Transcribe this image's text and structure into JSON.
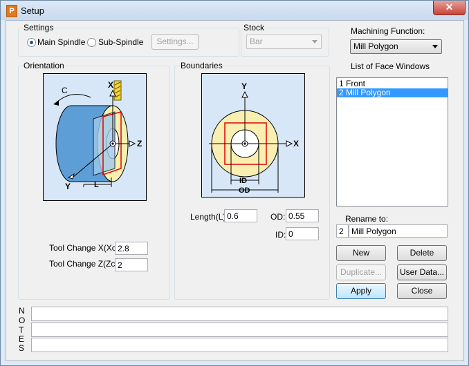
{
  "window": {
    "title": "Setup",
    "close_glyph": "✕"
  },
  "settings": {
    "group_label": "Settings",
    "main_spindle_label": "Main Spindle",
    "sub_spindle_label": "Sub-Spindle",
    "selected": "Main Spindle",
    "settings_button": "Settings..."
  },
  "stock": {
    "group_label": "Stock",
    "value": "Bar"
  },
  "machining_function": {
    "label": "Machining Function:",
    "value": "Mill Polygon"
  },
  "face_windows": {
    "label": "List of Face Windows",
    "items": [
      "1 Front",
      "2 Mill Polygon"
    ],
    "selected_index": 1
  },
  "rename": {
    "label": "Rename to:",
    "number": "2",
    "name": "Mill Polygon"
  },
  "orientation": {
    "group_label": "Orientation",
    "diagram_labels": {
      "c": "C",
      "x": "X",
      "z": "Z",
      "y": "Y",
      "l": "L"
    },
    "tool_change_x_label": "Tool Change X(Xc):",
    "tool_change_x_value": "2.8",
    "tool_change_z_label": "Tool Change Z(Zc):",
    "tool_change_z_value": "2"
  },
  "boundaries": {
    "group_label": "Boundaries",
    "diagram_labels": {
      "y": "Y",
      "x": "X",
      "id": "ID",
      "od": "OD"
    },
    "length_label": "Length(L):",
    "length_value": "0.6",
    "od_label": "OD:",
    "od_value": "0.55",
    "id_label": "ID:",
    "id_value": "0"
  },
  "buttons": {
    "new": "New",
    "delete": "Delete",
    "duplicate": "Duplicate...",
    "user_data": "User Data...",
    "apply": "Apply",
    "close": "Close"
  },
  "notes": {
    "letters": [
      "N",
      "O",
      "T",
      "E",
      "S"
    ]
  },
  "colors": {
    "selection": "#3399ff",
    "diagram_bg": "#d7e7f8",
    "cylinder": "#f9efb1",
    "section": "#e00000"
  }
}
